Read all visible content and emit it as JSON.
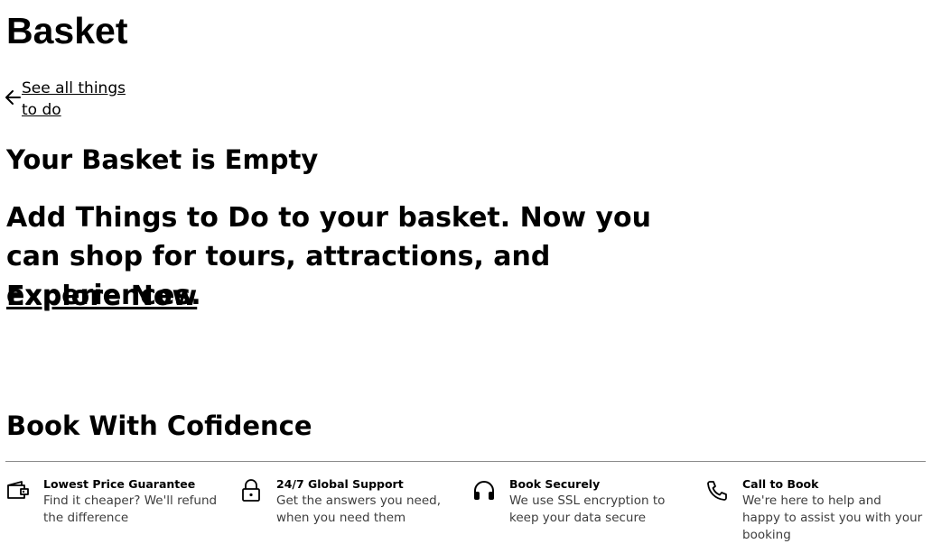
{
  "page": {
    "title": "Basket",
    "back_link": "See all things to do"
  },
  "empty_state": {
    "title": "Your Basket is Empty",
    "text": "Add Things to Do to your basket. Now you can shop for tours, attractions, and experiences.",
    "cta": "Explore Now"
  },
  "confidence": {
    "title": "Book With Cofidence",
    "features": [
      {
        "icon": "wallet-icon",
        "title": "Lowest Price Guarantee",
        "description": "Find it cheaper? We'll refund the difference"
      },
      {
        "icon": "lock-icon",
        "title": "24/7 Global Support",
        "description": "Get the answers you need, when you need them"
      },
      {
        "icon": "headphones-icon",
        "title": "Book Securely",
        "description": "We use SSL encryption to keep your data secure"
      },
      {
        "icon": "phone-icon",
        "title": "Call to Book",
        "description": "We're here to help and happy to assist you with your booking"
      }
    ]
  }
}
